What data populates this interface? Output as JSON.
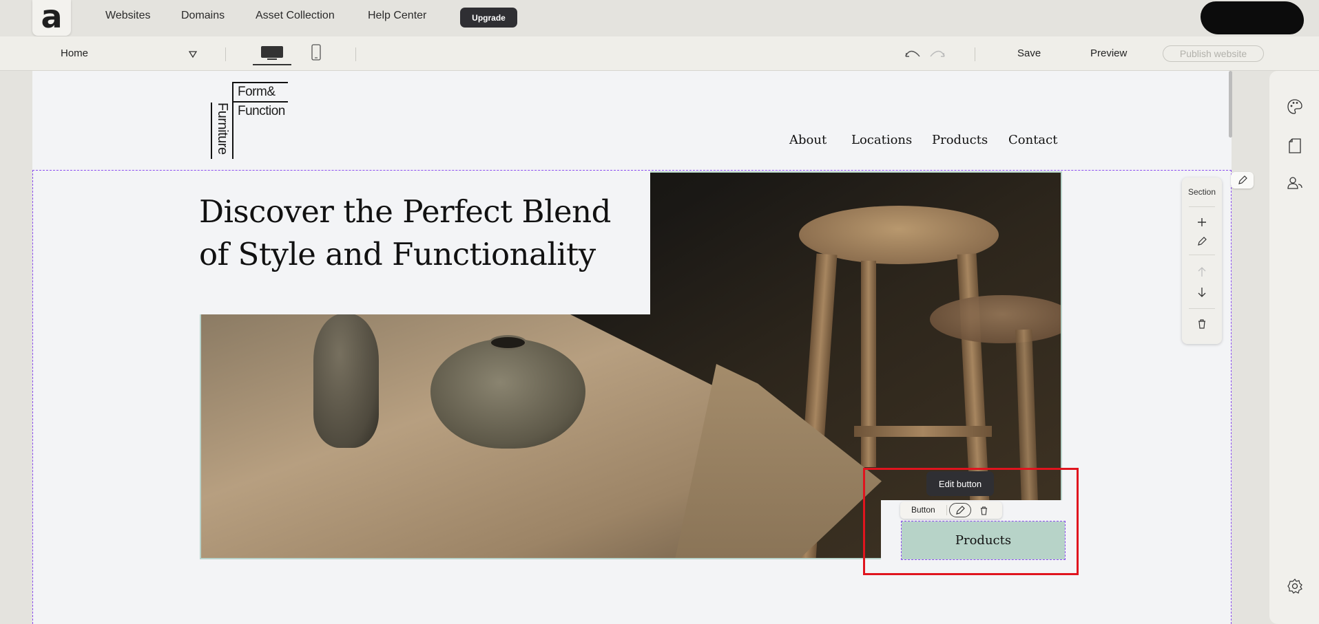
{
  "topnav": {
    "logo_glyph": "a",
    "links": [
      "Websites",
      "Domains",
      "Asset Collection",
      "Help Center"
    ],
    "upgrade_label": "Upgrade"
  },
  "toolbar": {
    "page_select": "Home",
    "save_label": "Save",
    "preview_label": "Preview",
    "publish_label": "Publish website"
  },
  "site": {
    "brand": {
      "top": "Form&",
      "middle": "Function",
      "vertical": "Furniture"
    },
    "nav": [
      "About",
      "Locations",
      "Products",
      "Contact"
    ],
    "headline": "Discover the Perfect Blend of Style and Functionality",
    "cta_label": "Products"
  },
  "section_tools": {
    "label": "Section"
  },
  "button_editor": {
    "tooltip": "Edit button",
    "label": "Button"
  },
  "colors": {
    "accent_purple": "#8a4bef",
    "cta_green": "#b7d3c8",
    "highlight_red": "#e0141e",
    "dark_button": "#2f2f33"
  },
  "icons": [
    "chevron-down-icon",
    "desktop-icon",
    "mobile-icon",
    "undo-icon",
    "redo-icon",
    "plus-icon",
    "pencil-icon",
    "arrow-up-icon",
    "arrow-down-icon",
    "trash-icon",
    "palette-icon",
    "page-icon",
    "users-icon",
    "gear-icon"
  ]
}
